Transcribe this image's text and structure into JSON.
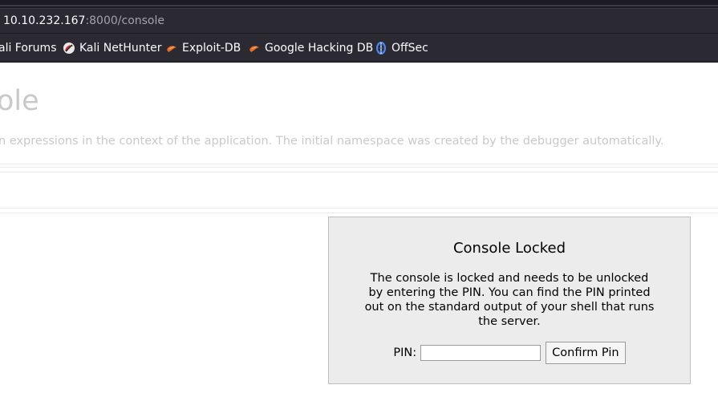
{
  "browser": {
    "url_host": "10.10.232.167",
    "url_path": ":8000/console",
    "bookmarks": [
      {
        "label": "ali Forums",
        "icon": "kali-forums-icon"
      },
      {
        "label": "Kali NetHunter",
        "icon": "kali-nethunter-icon"
      },
      {
        "label": "Exploit-DB",
        "icon": "exploit-db-icon"
      },
      {
        "label": "Google Hacking DB",
        "icon": "google-hacking-db-icon"
      },
      {
        "label": "OffSec",
        "icon": "offsec-icon"
      }
    ]
  },
  "page": {
    "title": "ole",
    "description": "n expressions in the context of the application. The initial namespace was created by the debugger automatically."
  },
  "modal": {
    "title": "Console Locked",
    "message": "The console is locked and needs to be unlocked by entering the PIN. You can find the PIN printed out on the standard output of your shell that runs the server.",
    "pin_label": "PIN:",
    "pin_value": "",
    "confirm_label": "Confirm Pin"
  }
}
